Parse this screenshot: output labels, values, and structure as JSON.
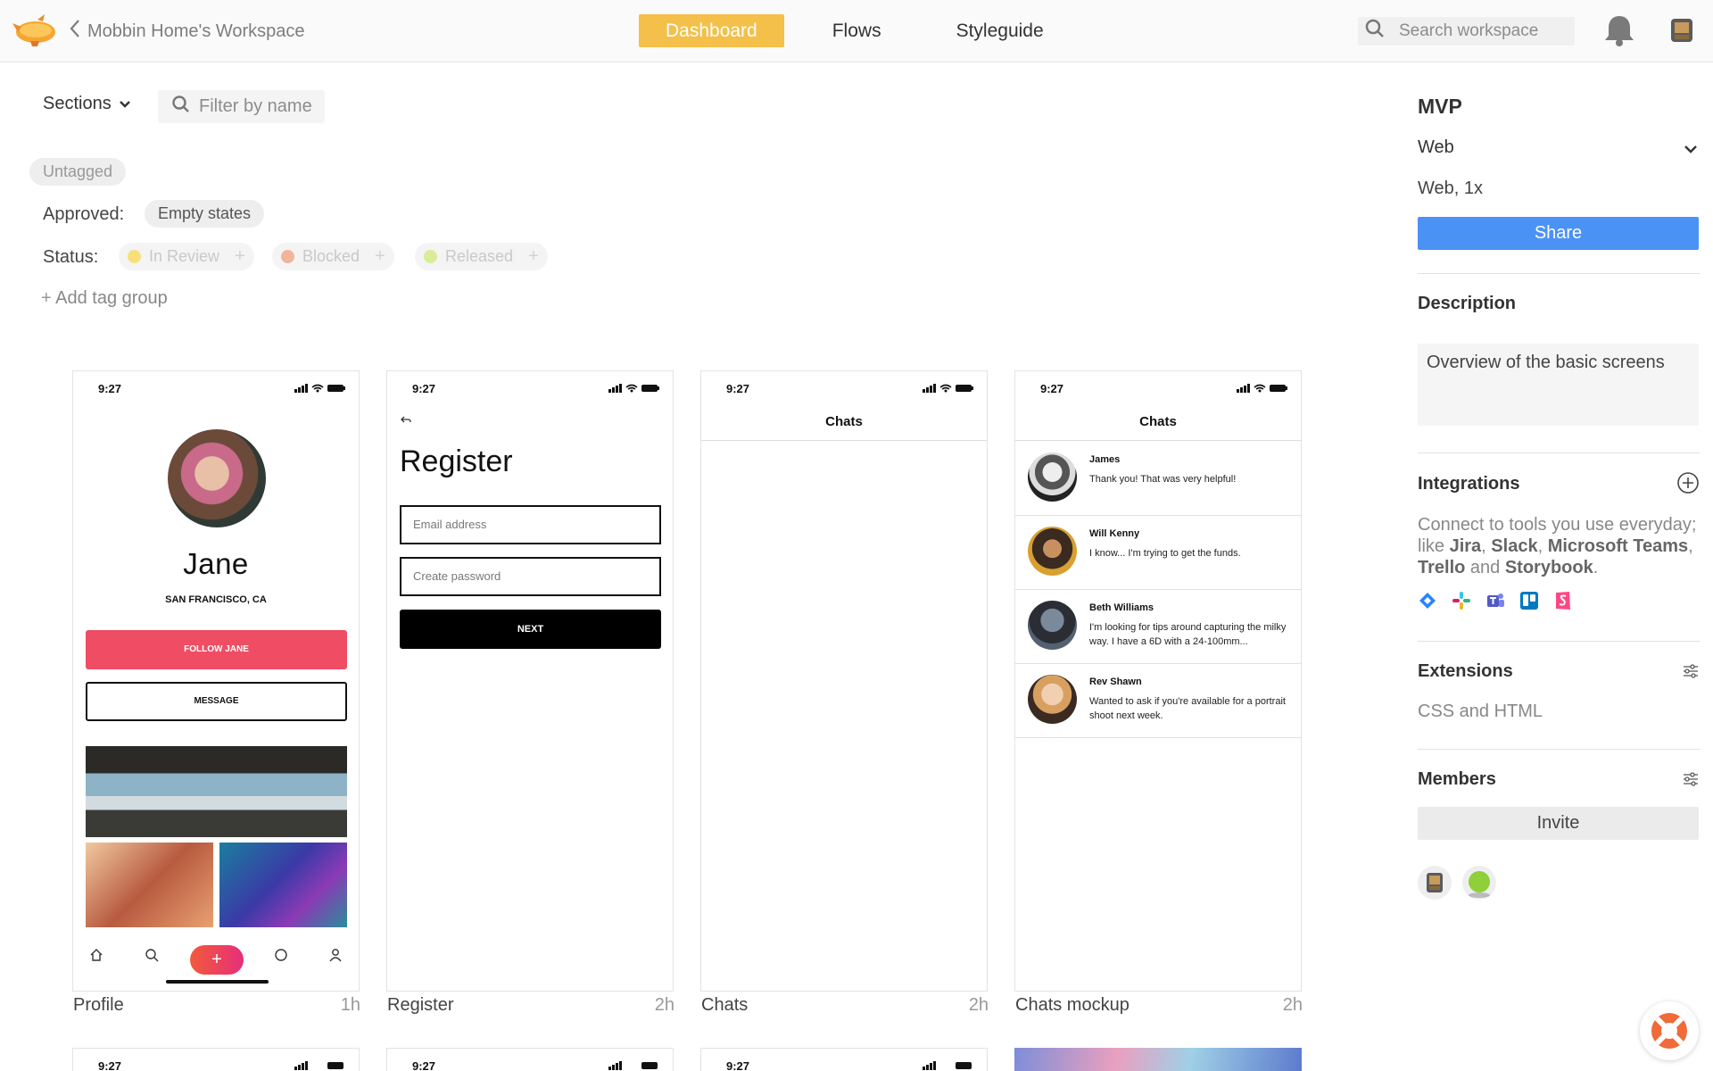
{
  "header": {
    "back_label": "Mobbin Home's Workspace",
    "tabs": [
      {
        "label": "Dashboard",
        "active": true
      },
      {
        "label": "Flows",
        "active": false
      },
      {
        "label": "Styleguide",
        "active": false
      }
    ],
    "search_placeholder": "Search workspace"
  },
  "filters": {
    "sections_label": "Sections",
    "filter_placeholder": "Filter by name",
    "untagged_label": "Untagged",
    "approved_label": "Approved:",
    "approved_tag": "Empty states",
    "status_label": "Status:",
    "status_tags": [
      {
        "label": "In Review",
        "color": "#f7e07a"
      },
      {
        "label": "Blocked",
        "color": "#f2b49a"
      },
      {
        "label": "Released",
        "color": "#d9ec9a"
      }
    ],
    "add_tag_group": "Add tag group"
  },
  "cards": [
    {
      "name": "Profile",
      "age": "1h",
      "time": "9:27",
      "profile_name": "Jane",
      "location": "SAN FRANCISCO, CA",
      "follow_label": "FOLLOW JANE",
      "message_label": "MESSAGE"
    },
    {
      "name": "Register",
      "age": "2h",
      "time": "9:27",
      "title": "Register",
      "email_placeholder": "Email address",
      "password_placeholder": "Create password",
      "next_label": "NEXT"
    },
    {
      "name": "Chats",
      "age": "2h",
      "time": "9:27",
      "title": "Chats"
    },
    {
      "name": "Chats mockup",
      "age": "2h",
      "time": "9:27",
      "title": "Chats",
      "chats": [
        {
          "name": "James",
          "message": "Thank you! That was very helpful!"
        },
        {
          "name": "Will Kenny",
          "message": "I know... I'm trying to get the funds."
        },
        {
          "name": "Beth Williams",
          "message": "I'm looking for tips around capturing the milky way. I have a 6D with a 24-100mm..."
        },
        {
          "name": "Rev Shawn",
          "message": "Wanted to ask if you're available for a portrait shoot next week."
        }
      ]
    }
  ],
  "bottom_cards": [
    {
      "time": "9:27"
    },
    {
      "time": "9:27"
    },
    {
      "time": "9:27"
    }
  ],
  "panel": {
    "title": "MVP",
    "platform": "Web",
    "size": "Web, 1x",
    "share_label": "Share",
    "description_heading": "Description",
    "description": "Overview of the basic screens",
    "integrations_heading": "Integrations",
    "integrations_text_1": "Connect to tools you use everyday; like ",
    "integrations_tools": [
      "Jira",
      "Slack",
      "Microsoft Teams",
      "Trello",
      "Storybook"
    ],
    "extensions_heading": "Extensions",
    "extensions_text": "CSS and HTML",
    "members_heading": "Members",
    "invite_label": "Invite"
  },
  "colors": {
    "accent": "#f4c04a",
    "share_blue": "#4b92f5",
    "follow_pink": "#ee4d64"
  }
}
